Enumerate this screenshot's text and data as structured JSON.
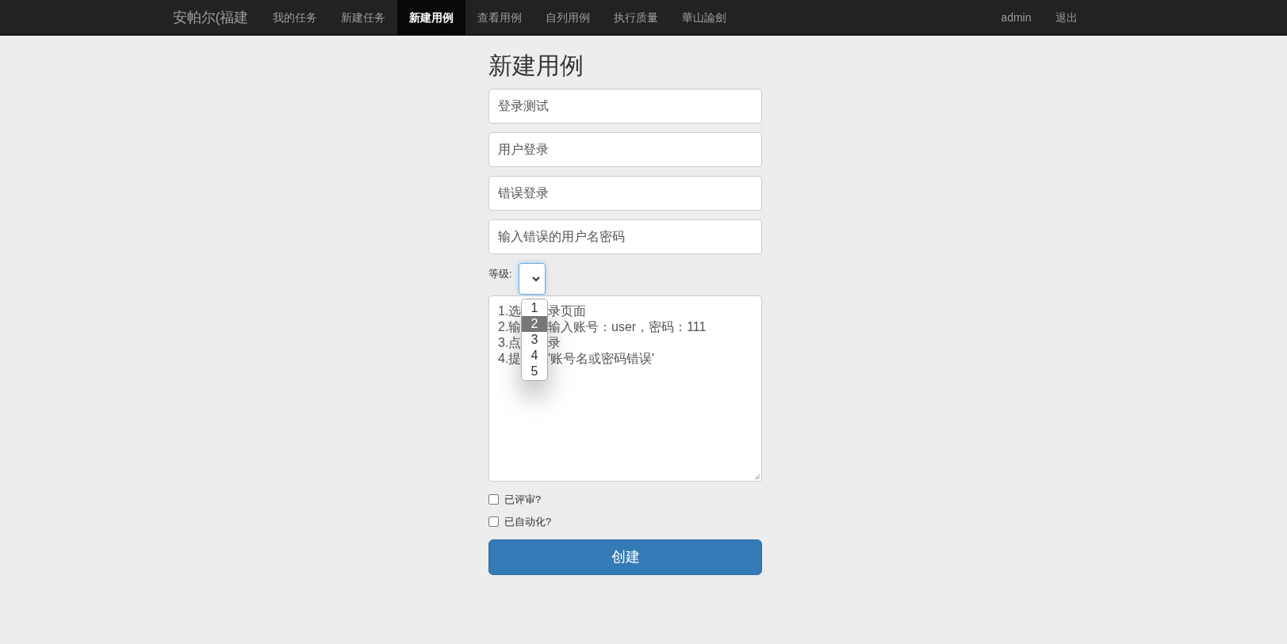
{
  "navbar": {
    "brand": "安帕尔(福建",
    "items": [
      {
        "label": "我的任务",
        "selected": false
      },
      {
        "label": "新建任务",
        "selected": false
      },
      {
        "label": "新建用例",
        "selected": true
      },
      {
        "label": "查看用例",
        "selected": false
      },
      {
        "label": "自列用例",
        "selected": false
      },
      {
        "label": "执行质量",
        "selected": false
      },
      {
        "label": "華山論劍",
        "selected": false
      }
    ],
    "user": "admin",
    "logout": "退出"
  },
  "form": {
    "title": "新建用例",
    "fields": [
      {
        "value": "登录测试"
      },
      {
        "value": "用户登录"
      },
      {
        "value": "错误登录"
      },
      {
        "value": "输入错误的用户名密码"
      }
    ],
    "level": {
      "label": "等级:",
      "expanded": true,
      "options": [
        {
          "label": "1",
          "selected": false
        },
        {
          "label": "2",
          "selected": true
        },
        {
          "label": "3",
          "selected": false
        },
        {
          "label": "4",
          "selected": false
        },
        {
          "label": "5",
          "selected": false
        }
      ]
    },
    "steps": [
      {
        "start": "1.选",
        "end": "录页面"
      },
      {
        "start": "2.输",
        "end": "输入账号：user，密码：111"
      },
      {
        "start": "3.点",
        "end": "录"
      },
      {
        "start": "4.提",
        "end": "'账号名或密码错误'"
      }
    ],
    "checkboxes": [
      {
        "label": "已评审?",
        "checked": false
      },
      {
        "label": "已自动化?",
        "checked": false
      }
    ],
    "submit": "创建"
  }
}
